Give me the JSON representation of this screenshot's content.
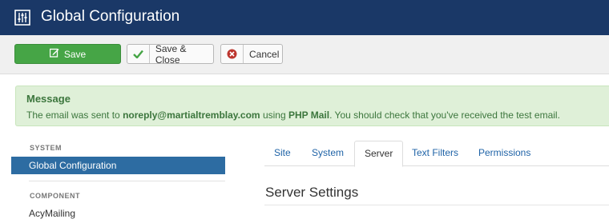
{
  "header": {
    "title": "Global Configuration",
    "icon": "equalizer-icon",
    "background": "#1a3867"
  },
  "toolbar": {
    "save_label": "Save",
    "save_close_label": "Save & Close",
    "cancel_label": "Cancel",
    "save_color": "#46a546"
  },
  "alert": {
    "heading": "Message",
    "text_1": "The email was sent to ",
    "email": "noreply@martialtremblay.com",
    "text_2": " using ",
    "mailer": "PHP Mail",
    "text_3": ". You should check that you've received the test email.",
    "background": "#dff0d8"
  },
  "sidebar": {
    "sections": [
      {
        "heading": "SYSTEM",
        "items": [
          "Global Configuration"
        ]
      },
      {
        "heading": "COMPONENT",
        "items": [
          "AcyMailing"
        ]
      }
    ],
    "active_color": "#2d6ca2"
  },
  "tabs": {
    "items": [
      "Site",
      "System",
      "Server",
      "Text Filters",
      "Permissions"
    ],
    "active": "Server"
  },
  "main": {
    "section_title": "Server Settings"
  }
}
